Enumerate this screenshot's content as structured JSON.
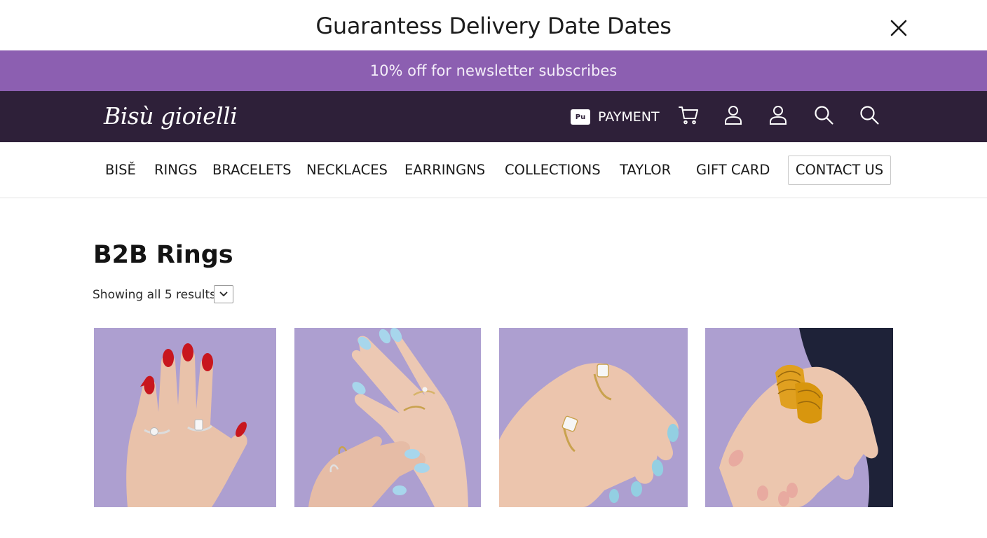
{
  "topbar": {
    "title": "Guarantess Delivery Date Dates"
  },
  "promo": {
    "text": "10% off for newsletter subscribes"
  },
  "header": {
    "logo": "Bisù gioielli",
    "payment_badge": "Pu",
    "payment_label": "PAYMENT",
    "icons": [
      "cart-icon",
      "user-icon",
      "user-icon",
      "search-icon",
      "search-icon"
    ]
  },
  "nav": {
    "items": [
      "BISĚ",
      "RINGS",
      "BRACELETS",
      "NECKLACES",
      "EARRINGNS",
      "COLLECTIONS",
      "TAYLOR",
      "GIFT CARD"
    ],
    "contact": "CONTACT US"
  },
  "main": {
    "title": "B2B Rings",
    "result_count": "Showing all 5 results"
  },
  "colors": {
    "promo": "#8c5fb1",
    "header": "#2e2039",
    "product_background": "#ad9fd0"
  },
  "products": [
    {
      "image": "hand-with-red-nails-and-diamond-rings"
    },
    {
      "image": "hands-with-blue-nails-and-stacked-rings"
    },
    {
      "image": "hand-with-blue-nails-and-diamond-rings"
    },
    {
      "image": "hand-with-gold-chunky-rings"
    }
  ]
}
